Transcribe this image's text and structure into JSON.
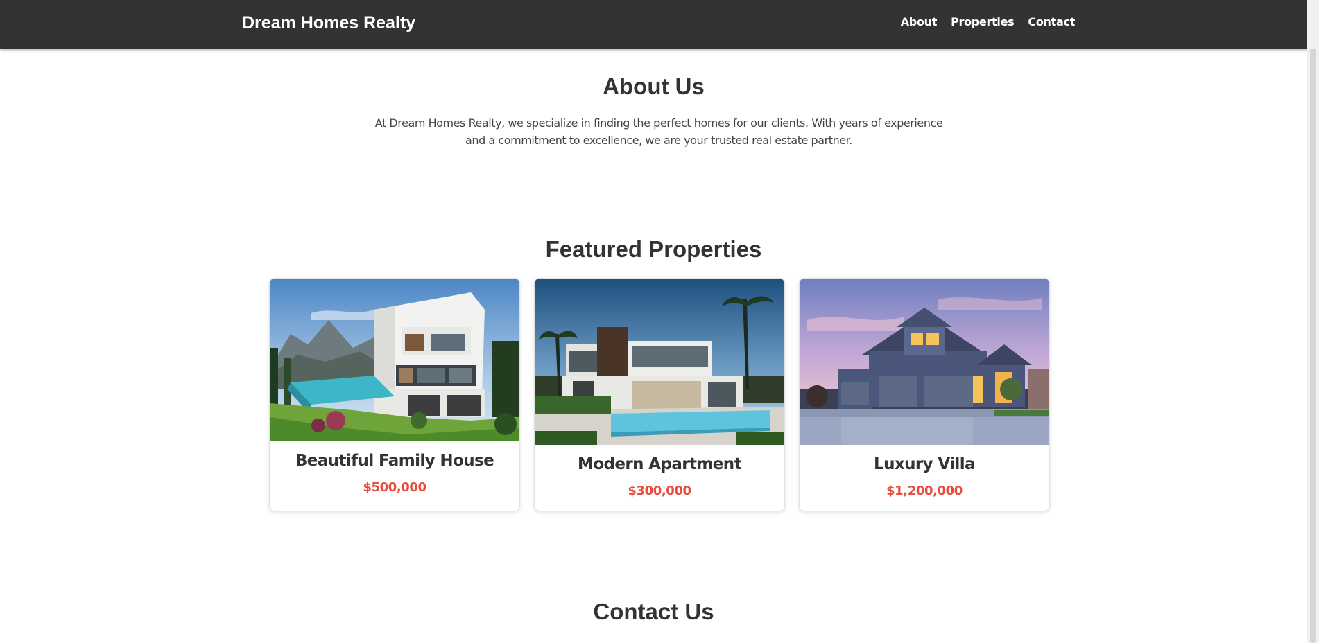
{
  "header": {
    "brand": "Dream Homes Realty",
    "nav": [
      "About",
      "Properties",
      "Contact"
    ]
  },
  "about": {
    "title": "About Us",
    "text": "At Dream Homes Realty, we specialize in finding the perfect homes for our clients. With years of experience and a commitment to excellence, we are your trusted real estate partner."
  },
  "properties": {
    "title": "Featured Properties",
    "items": [
      {
        "name": "Beautiful Family House",
        "price": "$500,000",
        "image": "modern-white-villa-photo"
      },
      {
        "name": "Modern Apartment",
        "price": "$300,000",
        "image": "modern-house-with-pool-photo"
      },
      {
        "name": "Luxury Villa",
        "price": "$1,200,000",
        "image": "suburban-house-at-dusk-photo"
      }
    ]
  },
  "contact": {
    "title": "Contact Us"
  },
  "colors": {
    "header_bg": "#333333",
    "price": "#e74c3c",
    "heading": "#333333",
    "text": "#444444"
  }
}
